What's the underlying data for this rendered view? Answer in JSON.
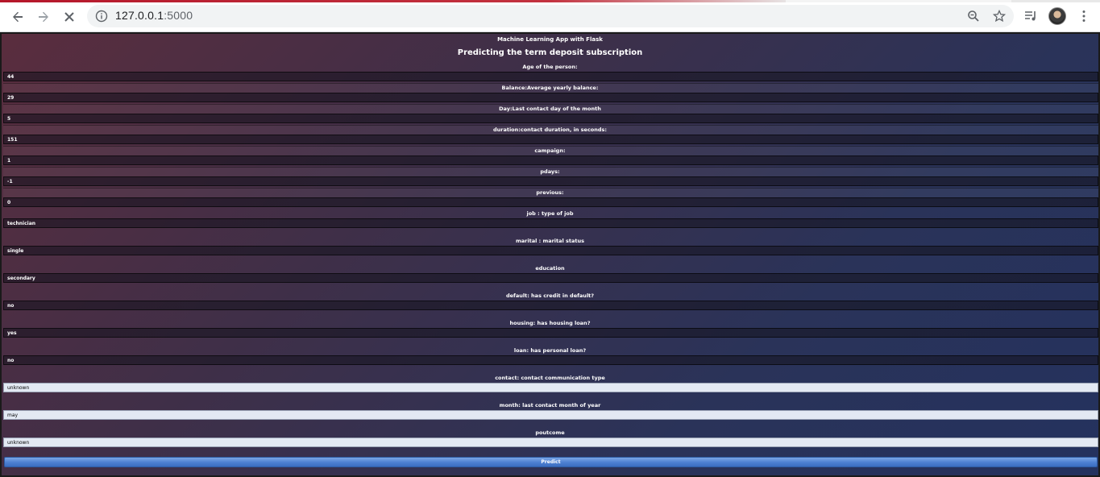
{
  "browser": {
    "url_host": "127.0.0.1",
    "url_port": ":5000"
  },
  "page": {
    "app_title": "Machine Learning App with Flask",
    "heading": "Predicting the term deposit subscription",
    "predict_label": "Predict"
  },
  "fields": [
    {
      "label": "Age of the person:",
      "value": "44"
    },
    {
      "label": "Balance:Average yearly balance:",
      "value": "29"
    },
    {
      "label": "Day:Last contact day of the month",
      "value": "5"
    },
    {
      "label": "duration:contact duration, in seconds:",
      "value": "151"
    },
    {
      "label": "campaign:",
      "value": "1"
    },
    {
      "label": "pdays:",
      "value": "-1"
    },
    {
      "label": "previous:",
      "value": "0"
    },
    {
      "label": "job : type of job",
      "value": "technician"
    },
    {
      "label": "marital : marital status",
      "value": "single"
    },
    {
      "label": "education",
      "value": "secondary"
    },
    {
      "label": "default: has credit in default?",
      "value": "no"
    },
    {
      "label": "housing: has housing loan?",
      "value": "yes"
    },
    {
      "label": "loan: has personal loan?",
      "value": "no"
    },
    {
      "label": "contact: contact communication type",
      "value": "unknown"
    },
    {
      "label": "month: last contact month of year",
      "value": "may"
    },
    {
      "label": "poutcome",
      "value": "unknown"
    }
  ]
}
